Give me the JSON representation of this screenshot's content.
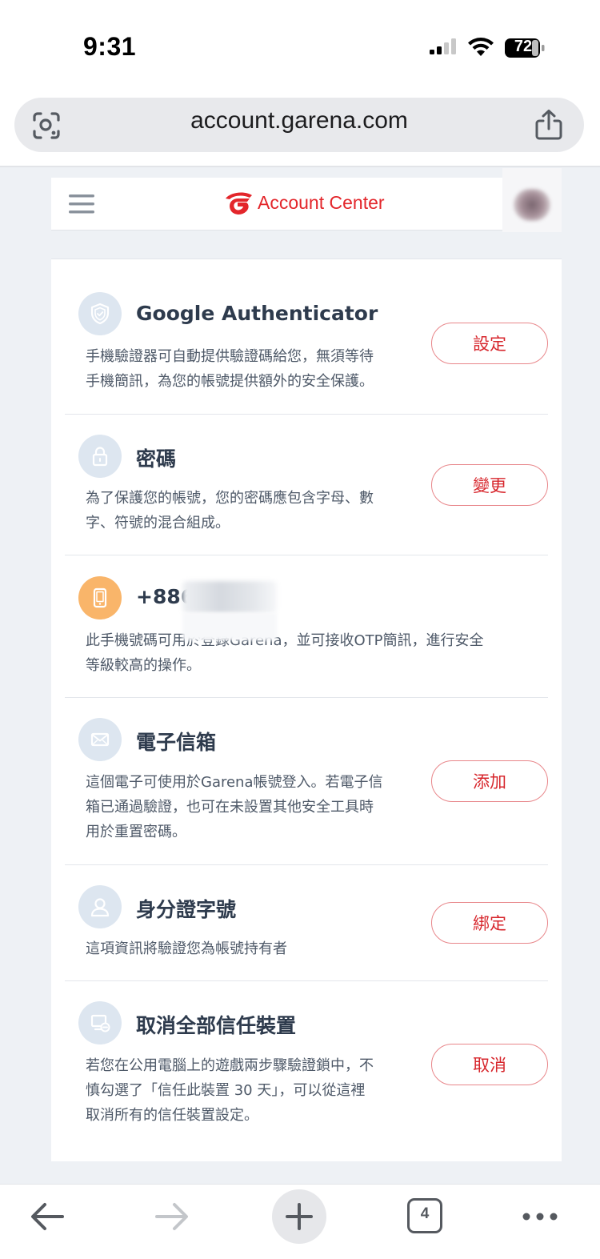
{
  "status_bar": {
    "time": "9:31",
    "battery": "72"
  },
  "browser": {
    "url": "account.garena.com",
    "open_tabs": "4"
  },
  "header": {
    "logo_text": "Account Center"
  },
  "security_items": [
    {
      "icon": "shield-icon",
      "title": "Google Authenticator",
      "desc_lines": [
        "手機驗證器可自動提供驗證碼給您，無須等待",
        "手機簡訊，為您的帳號提供額外的安全保護。"
      ],
      "button": "設定"
    },
    {
      "icon": "lock-icon",
      "title": "密碼",
      "desc_lines": [
        "為了保護您的帳號，您的密碼應包含字母、數",
        "字、符號的混合組成。"
      ],
      "button": "變更"
    },
    {
      "icon": "phone-icon",
      "title": "+886",
      "desc_lines": [
        "此手機號碼可用於登錄Garena，並可接收OTP簡訊，進行安全",
        "等級較高的操作。"
      ],
      "button": ""
    },
    {
      "icon": "mail-icon",
      "title": "電子信箱",
      "desc_lines": [
        "這個電子可使用於Garena帳號登入。若電子信",
        "箱已通過驗證，也可在未設置其他安全工具時",
        "用於重置密碼。"
      ],
      "button": "添加"
    },
    {
      "icon": "user-icon",
      "title": "身分證字號",
      "desc_lines": [
        "這項資訊將驗證您為帳號持有者"
      ],
      "button": "綁定"
    },
    {
      "icon": "device-icon",
      "title": "取消全部信任裝置",
      "desc_lines": [
        "若您在公用電腦上的遊戲兩步驟驗證鎖中，不",
        "慎勾選了「信任此裝置 30 天」，可以從這裡",
        "取消所有的信任裝置設定。"
      ],
      "button": "取消"
    }
  ],
  "colors": {
    "accent": "#d7262c",
    "button_border": "#e8868a",
    "icon_bg": "#dde6f0",
    "phone_icon_bg": "#f9b56a",
    "page_bg": "#eef1f5"
  }
}
